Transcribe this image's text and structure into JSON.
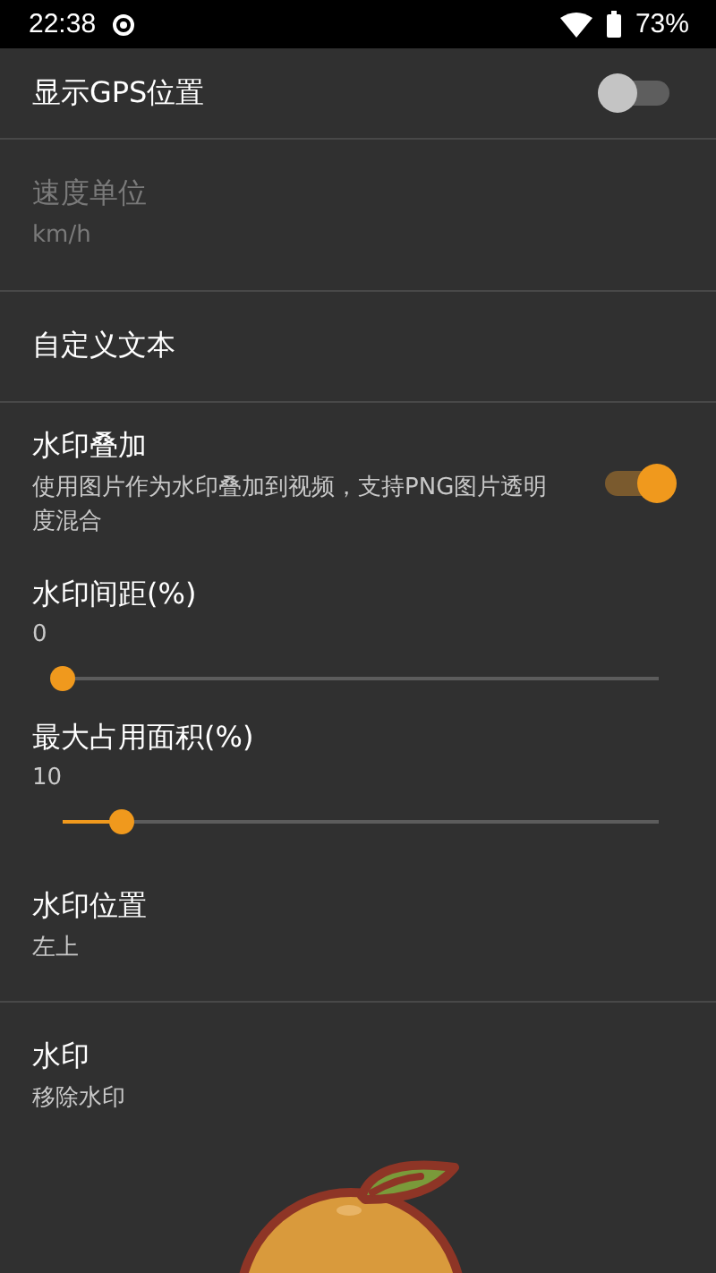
{
  "status_bar": {
    "time": "22:38",
    "battery": "73%"
  },
  "sections": [
    {
      "items": [
        {
          "kind": "switch",
          "title": "显示GPS位置",
          "on": false
        }
      ]
    },
    {
      "items": [
        {
          "kind": "text",
          "title": "速度单位",
          "summary": "km/h",
          "disabled": true
        }
      ]
    },
    {
      "items": [
        {
          "kind": "text",
          "title": "自定义文本",
          "disabled": false
        }
      ]
    },
    {
      "items": [
        {
          "kind": "switch",
          "title": "水印叠加",
          "summary": "使用图片作为水印叠加到视频，支持PNG图片透明度混合",
          "on": true
        },
        {
          "kind": "slider",
          "title": "水印间距(%)",
          "reading": "0",
          "level": 0
        },
        {
          "kind": "slider",
          "title": "最大占用面积(%)",
          "reading": "10",
          "level": 0.1
        },
        {
          "kind": "text",
          "title": "水印位置",
          "summary": "左上",
          "disabled": false
        }
      ]
    },
    {
      "items": [
        {
          "kind": "text",
          "title": "水印",
          "summary": "移除水印",
          "disabled": false
        }
      ]
    }
  ],
  "preview": {
    "kind": "fruit"
  }
}
